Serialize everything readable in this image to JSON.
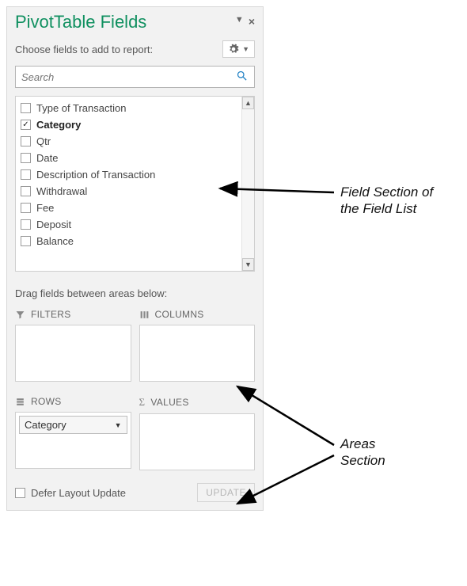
{
  "pane": {
    "title": "PivotTable Fields",
    "subtitle": "Choose fields to add to report:",
    "search_placeholder": "Search"
  },
  "fields": [
    {
      "label": "Type of Transaction",
      "checked": false
    },
    {
      "label": "Category",
      "checked": true
    },
    {
      "label": "Qtr",
      "checked": false
    },
    {
      "label": "Date",
      "checked": false
    },
    {
      "label": "Description of Transaction",
      "checked": false
    },
    {
      "label": "Withdrawal",
      "checked": false
    },
    {
      "label": "Fee",
      "checked": false
    },
    {
      "label": "Deposit",
      "checked": false
    },
    {
      "label": "Balance",
      "checked": false
    }
  ],
  "drag_label": "Drag fields between areas below:",
  "areas": {
    "filters": "FILTERS",
    "columns": "COLUMNS",
    "rows": "ROWS",
    "values": "VALUES",
    "rows_item": "Category"
  },
  "footer": {
    "defer": "Defer Layout Update",
    "update": "UPDATE"
  },
  "annotations": {
    "fields_section": "Field Section of\nthe Field List",
    "areas_section": "Areas\nSection"
  }
}
